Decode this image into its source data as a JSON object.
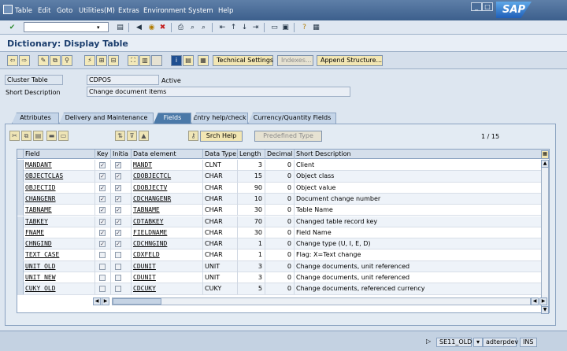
{
  "menu": {
    "items": [
      "Table",
      "Edit",
      "Goto",
      "Utilities(M)",
      "Extras",
      "Environment",
      "System",
      "Help"
    ],
    "logo": "SAP"
  },
  "title": "Dictionary: Display Table",
  "toolbar": {
    "technical_settings": "Technical Settings",
    "indexes": "Indexes...",
    "append_structure": "Append Structure..."
  },
  "header": {
    "table_type_label": "Cluster Table",
    "table_name": "CDPOS",
    "status": "Active",
    "short_desc_label": "Short Description",
    "short_desc": "Change document items"
  },
  "tabs": [
    "Attributes",
    "Delivery and Maintenance",
    "Fields",
    "Entry help/check",
    "Currency/Quantity Fields"
  ],
  "active_tab": "Fields",
  "fields_tab": {
    "srch_help": "Srch Help",
    "predefined_type": "Predefined Type",
    "counter": "1  /  15",
    "columns": [
      "Field",
      "Key",
      "Initia",
      "Data element",
      "Data Type",
      "Length",
      "Decimal",
      "Short Description"
    ],
    "rows": [
      {
        "field": "MANDANT",
        "key": true,
        "init": true,
        "elem": "MANDT",
        "type": "CLNT",
        "len": "3",
        "dec": "0",
        "desc": "Client"
      },
      {
        "field": "OBJECTCLAS",
        "key": true,
        "init": true,
        "elem": "CDOBJECTCL",
        "type": "CHAR",
        "len": "15",
        "dec": "0",
        "desc": "Object class"
      },
      {
        "field": "OBJECTID",
        "key": true,
        "init": true,
        "elem": "CDOBJECTV",
        "type": "CHAR",
        "len": "90",
        "dec": "0",
        "desc": "Object value"
      },
      {
        "field": "CHANGENR",
        "key": true,
        "init": true,
        "elem": "CDCHANGENR",
        "type": "CHAR",
        "len": "10",
        "dec": "0",
        "desc": "Document change number"
      },
      {
        "field": "TABNAME",
        "key": true,
        "init": true,
        "elem": "TABNAME",
        "type": "CHAR",
        "len": "30",
        "dec": "0",
        "desc": "Table Name"
      },
      {
        "field": "TABKEY",
        "key": true,
        "init": true,
        "elem": "CDTABKEY",
        "type": "CHAR",
        "len": "70",
        "dec": "0",
        "desc": "Changed table record key"
      },
      {
        "field": "FNAME",
        "key": true,
        "init": true,
        "elem": "FIELDNAME",
        "type": "CHAR",
        "len": "30",
        "dec": "0",
        "desc": "Field Name"
      },
      {
        "field": "CHNGIND",
        "key": true,
        "init": true,
        "elem": "CDCHNGIND",
        "type": "CHAR",
        "len": "1",
        "dec": "0",
        "desc": "Change type (U, I, E, D)"
      },
      {
        "field": "TEXT_CASE",
        "key": false,
        "init": false,
        "elem": "CDXFELD",
        "type": "CHAR",
        "len": "1",
        "dec": "0",
        "desc": "Flag: X=Text change"
      },
      {
        "field": "UNIT_OLD",
        "key": false,
        "init": false,
        "elem": "CDUNIT",
        "type": "UNIT",
        "len": "3",
        "dec": "0",
        "desc": "Change documents, unit referenced"
      },
      {
        "field": "UNIT_NEW",
        "key": false,
        "init": false,
        "elem": "CDUNIT",
        "type": "UNIT",
        "len": "3",
        "dec": "0",
        "desc": "Change documents, unit referenced"
      },
      {
        "field": "CUKY_OLD",
        "key": false,
        "init": false,
        "elem": "CDCUKY",
        "type": "CUKY",
        "len": "5",
        "dec": "0",
        "desc": "Change documents, referenced currency"
      }
    ]
  },
  "status": {
    "transaction": "SE11_OLD",
    "server": "adterpdev",
    "mode": "INS"
  }
}
